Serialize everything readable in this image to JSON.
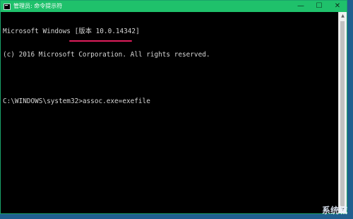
{
  "window": {
    "title": "管理员: 命令提示符",
    "controls": {
      "minimize": "—",
      "maximize": "☐",
      "close": "✕"
    }
  },
  "console": {
    "lines": [
      "Microsoft Windows [版本 10.0.14342]",
      "(c) 2016 Microsoft Corporation. All rights reserved.",
      "",
      "C:\\WINDOWS\\system32>assoc.exe=exefile"
    ]
  },
  "scrollbar": {
    "up": "▲",
    "down": "▼"
  },
  "watermark": {
    "text": "系统城"
  }
}
